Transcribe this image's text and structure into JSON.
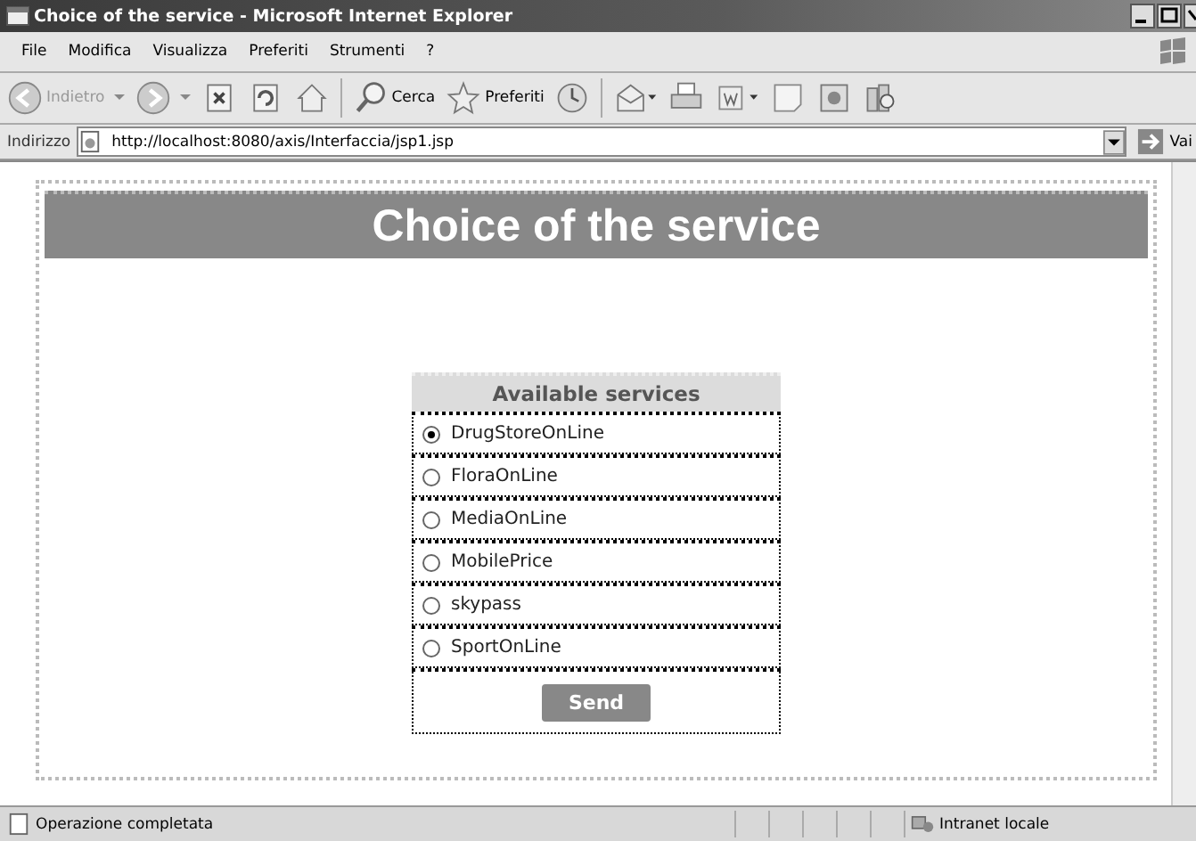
{
  "window": {
    "title": "Choice of the service - Microsoft Internet Explorer"
  },
  "menu": [
    "File",
    "Modifica",
    "Visualizza",
    "Preferiti",
    "Strumenti",
    "?"
  ],
  "toolbar": [
    {
      "kind": "back",
      "label": "Indietro",
      "disabled": true
    },
    {
      "kind": "forward",
      "disabled": true
    },
    {
      "kind": "stop"
    },
    {
      "kind": "refresh"
    },
    {
      "kind": "home"
    },
    {
      "kind": "search",
      "label": "Cerca"
    },
    {
      "kind": "favorites",
      "label": "Preferiti"
    },
    {
      "kind": "history"
    },
    {
      "kind": "mail"
    },
    {
      "kind": "print"
    },
    {
      "kind": "word"
    },
    {
      "kind": "note"
    },
    {
      "kind": "tool"
    },
    {
      "kind": "tool2"
    }
  ],
  "address": {
    "label": "Indirizzo",
    "value": "http://localhost:8080/axis/Interfaccia/jsp1.jsp",
    "go": "Vai"
  },
  "page": {
    "heading": "Choice of the service",
    "table_title": "Available services",
    "services": [
      {
        "label": "DrugStoreOnLine",
        "selected": true
      },
      {
        "label": "FloraOnLine",
        "selected": false
      },
      {
        "label": "MediaOnLine",
        "selected": false
      },
      {
        "label": "MobilePrice",
        "selected": false
      },
      {
        "label": "skypass",
        "selected": false
      },
      {
        "label": "SportOnLine",
        "selected": false
      }
    ],
    "submit": "Send"
  },
  "status_bar": {
    "text": "Operazione completata",
    "zone": "Intranet locale"
  }
}
